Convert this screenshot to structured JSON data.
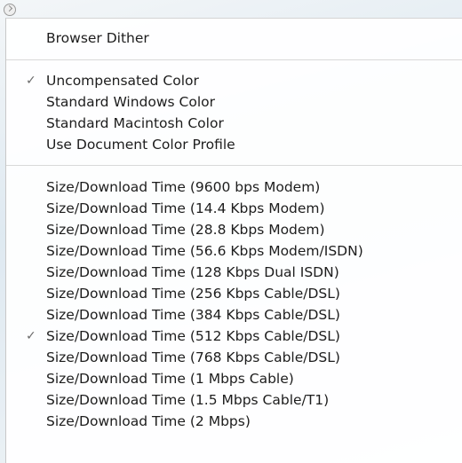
{
  "menu": {
    "groups": [
      [
        {
          "label": "Browser Dither",
          "checked": false
        }
      ],
      [
        {
          "label": "Uncompensated Color",
          "checked": true
        },
        {
          "label": "Standard Windows Color",
          "checked": false
        },
        {
          "label": "Standard Macintosh Color",
          "checked": false
        },
        {
          "label": "Use Document Color Profile",
          "checked": false
        }
      ],
      [
        {
          "label": "Size/Download Time (9600 bps Modem)",
          "checked": false
        },
        {
          "label": "Size/Download Time (14.4 Kbps Modem)",
          "checked": false
        },
        {
          "label": "Size/Download Time (28.8 Kbps Modem)",
          "checked": false
        },
        {
          "label": "Size/Download Time (56.6 Kbps Modem/ISDN)",
          "checked": false
        },
        {
          "label": "Size/Download Time (128 Kbps Dual ISDN)",
          "checked": false
        },
        {
          "label": "Size/Download Time (256 Kbps Cable/DSL)",
          "checked": false
        },
        {
          "label": "Size/Download Time (384 Kbps Cable/DSL)",
          "checked": false
        },
        {
          "label": "Size/Download Time (512 Kbps Cable/DSL)",
          "checked": true
        },
        {
          "label": "Size/Download Time (768 Kbps Cable/DSL)",
          "checked": false
        },
        {
          "label": "Size/Download Time (1 Mbps Cable)",
          "checked": false
        },
        {
          "label": "Size/Download Time (1.5 Mbps Cable/T1)",
          "checked": false
        },
        {
          "label": "Size/Download Time (2 Mbps)",
          "checked": false
        }
      ]
    ],
    "check_glyph": "✓"
  }
}
